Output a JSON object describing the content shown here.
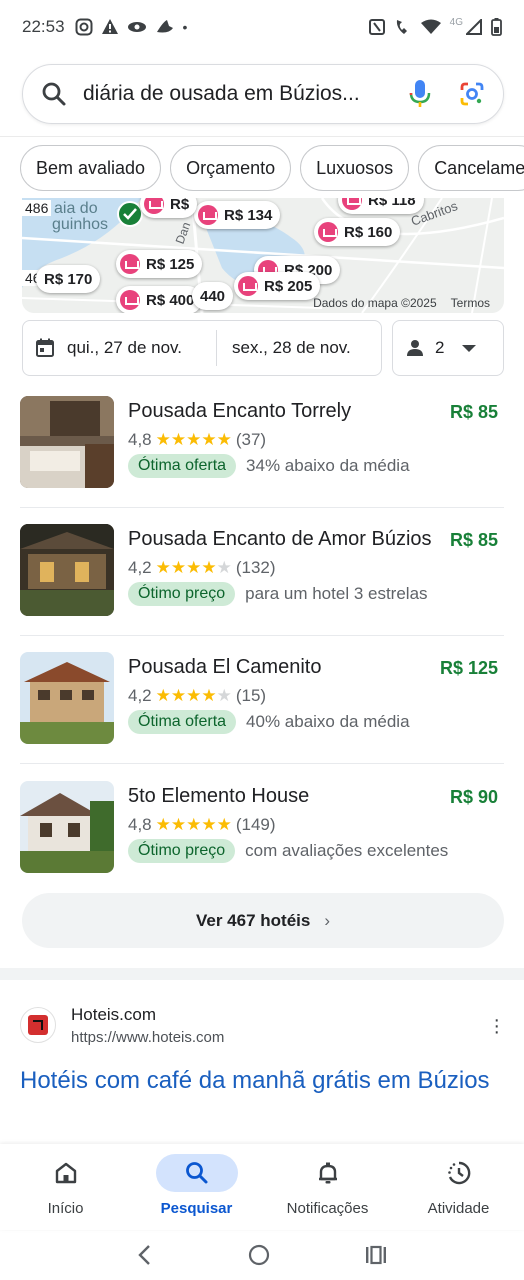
{
  "status_bar": {
    "time": "22:53",
    "network": "4G"
  },
  "search": {
    "query": "diária de ousada em Búzios..."
  },
  "chips": [
    "Bem avaliado",
    "Orçamento",
    "Luxuosos",
    "Cancelame"
  ],
  "map": {
    "credit": "Dados do mapa ©2025",
    "terms": "Termos",
    "labels": [
      "aia do",
      "guinhos",
      "486",
      "46",
      "Cabritos",
      "Dan"
    ],
    "pins": [
      "R$ 134",
      "R$ 160",
      "R$ 125",
      "R$ 170",
      "R$ 200",
      "R$ 205",
      "R$ 400",
      "440",
      "R$",
      "R$ 118"
    ]
  },
  "dates": {
    "checkin": "qui., 27 de nov.",
    "checkout": "sex., 28 de nov.",
    "guests": "2"
  },
  "hotels": [
    {
      "name": "Pousada Encanto Torrely",
      "price": "R$ 85",
      "rating": "4,8",
      "stars": 5,
      "reviews": "(37)",
      "badge": "Ótima oferta",
      "note": "34% abaixo da média"
    },
    {
      "name": "Pousada Encanto de Amor Búzios",
      "price": "R$ 85",
      "rating": "4,2",
      "stars": 4,
      "reviews": "(132)",
      "badge": "Ótimo preço",
      "note": "para um hotel 3 estrelas"
    },
    {
      "name": "Pousada El Camenito",
      "price": "R$ 125",
      "rating": "4,2",
      "stars": 4,
      "reviews": "(15)",
      "badge": "Ótima oferta",
      "note": "40% abaixo da média"
    },
    {
      "name": "5to Elemento House",
      "price": "R$ 90",
      "rating": "4,8",
      "stars": 5,
      "reviews": "(149)",
      "badge": "Ótimo preço",
      "note": "com avaliações excelentes"
    }
  ],
  "more_button": "Ver 467 hotéis",
  "result": {
    "site": "Hoteis.com",
    "url": "https://www.hoteis.com",
    "title": "Hotéis com café da manhã grátis em Búzios"
  },
  "bottom_nav": [
    {
      "label": "Início",
      "icon": "home-icon"
    },
    {
      "label": "Pesquisar",
      "icon": "search-icon"
    },
    {
      "label": "Notificações",
      "icon": "bell-icon"
    },
    {
      "label": "Atividade",
      "icon": "history-icon"
    }
  ]
}
